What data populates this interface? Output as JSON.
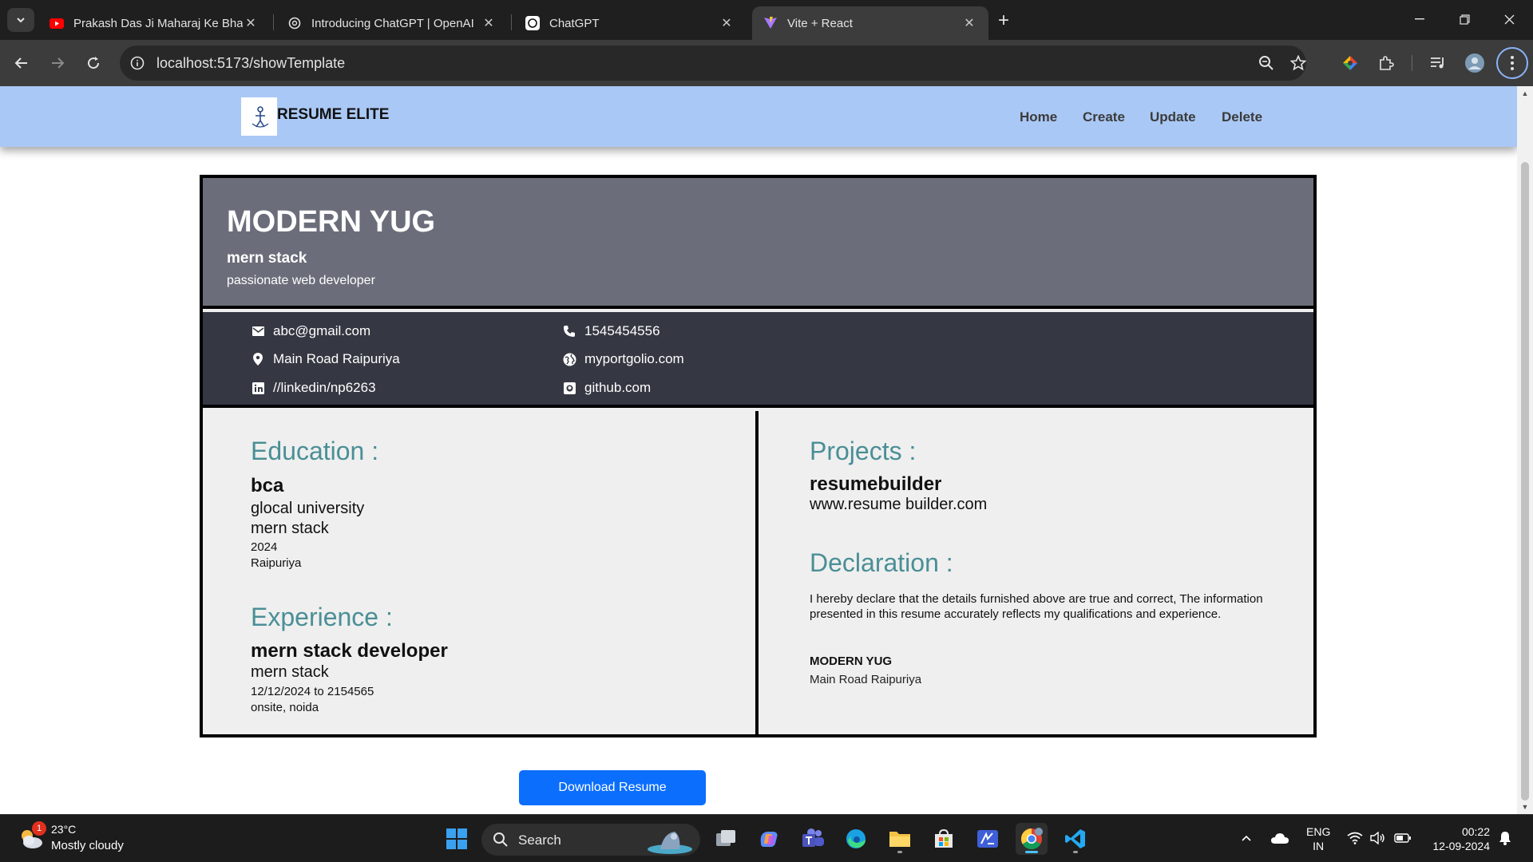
{
  "browser": {
    "tabs": [
      {
        "title": "Prakash Das Ji Maharaj Ke Bhaj",
        "icon": "youtube-icon"
      },
      {
        "title": "Introducing ChatGPT | OpenAI",
        "icon": "openai-icon"
      },
      {
        "title": "ChatGPT",
        "icon": "chatgpt-icon"
      },
      {
        "title": "Vite + React",
        "icon": "vite-icon",
        "active": true
      }
    ],
    "url": "localhost:5173/showTemplate"
  },
  "site": {
    "brand": "RESUME ELITE",
    "nav": [
      "Home",
      "Create",
      "Update",
      "Delete"
    ]
  },
  "resume": {
    "name": "MODERN YUG",
    "role": "mern stack",
    "tagline": "passionate web developer",
    "contact": {
      "email": "abc@gmail.com",
      "phone": "1545454556",
      "address": "Main Road Raipuriya",
      "portfolio": "myportgolio.com",
      "linkedin": "//linkedin/np6263",
      "github": "github.com"
    },
    "education": {
      "heading": "Education :",
      "degree": "bca",
      "university": "glocal university",
      "stream": "mern stack",
      "year": "2024",
      "city": "Raipuriya"
    },
    "experience": {
      "heading": "Experience :",
      "title": "mern stack developer",
      "field": "mern stack",
      "period": "12/12/2024 to 2154565",
      "location": "onsite, noida"
    },
    "projects": {
      "heading": "Projects :",
      "name": "resumebuilder",
      "link": "www.resume builder.com"
    },
    "declaration": {
      "heading": "Declaration :",
      "text": "I hereby declare that the details furnished above are true and correct, The information presented in this resume accurately reflects my qualifications and experience.",
      "signature_name": "MODERN YUG",
      "signature_address": "Main Road Raipuriya"
    }
  },
  "download_label": "Download Resume",
  "taskbar": {
    "weather_temp": "23°C",
    "weather_desc": "Mostly cloudy",
    "weather_badge": "1",
    "search_label": "Search",
    "lang_line1": "ENG",
    "lang_line2": "IN",
    "time": "00:22",
    "date": "12-09-2024"
  },
  "colors": {
    "nav_bg": "#aac8f5",
    "header_bg": "#6b6e7a",
    "contact_bg": "#353842",
    "section_heading": "#4a8f96",
    "button": "#0b6efd"
  }
}
